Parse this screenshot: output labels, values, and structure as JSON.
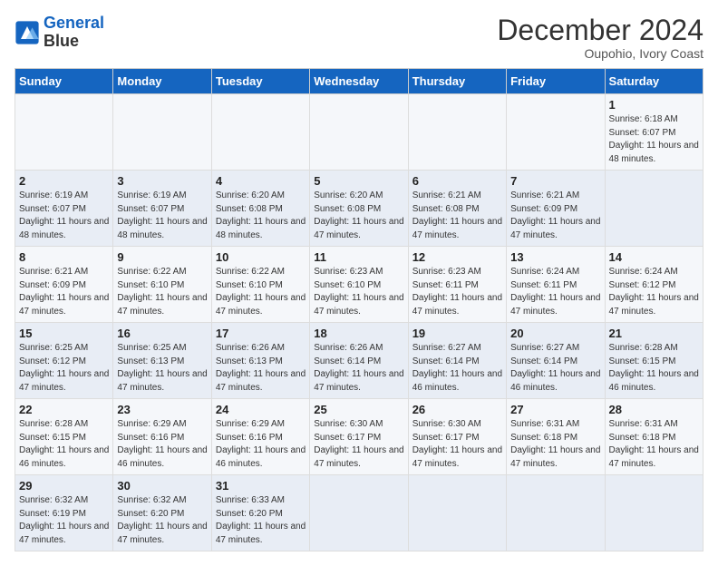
{
  "header": {
    "logo_line1": "General",
    "logo_line2": "Blue",
    "title": "December 2024",
    "subtitle": "Oupohio, Ivory Coast"
  },
  "calendar": {
    "days_of_week": [
      "Sunday",
      "Monday",
      "Tuesday",
      "Wednesday",
      "Thursday",
      "Friday",
      "Saturday"
    ],
    "weeks": [
      [
        null,
        null,
        null,
        null,
        null,
        null,
        {
          "day": 1,
          "rise": "6:18 AM",
          "set": "6:07 PM",
          "daylight": "11 hours and 48 minutes."
        }
      ],
      [
        {
          "day": 2,
          "rise": "6:19 AM",
          "set": "6:07 PM",
          "daylight": "11 hours and 48 minutes."
        },
        {
          "day": 3,
          "rise": "6:19 AM",
          "set": "6:07 PM",
          "daylight": "11 hours and 48 minutes."
        },
        {
          "day": 4,
          "rise": "6:20 AM",
          "set": "6:08 PM",
          "daylight": "11 hours and 48 minutes."
        },
        {
          "day": 5,
          "rise": "6:20 AM",
          "set": "6:08 PM",
          "daylight": "11 hours and 47 minutes."
        },
        {
          "day": 6,
          "rise": "6:21 AM",
          "set": "6:08 PM",
          "daylight": "11 hours and 47 minutes."
        },
        {
          "day": 7,
          "rise": "6:21 AM",
          "set": "6:09 PM",
          "daylight": "11 hours and 47 minutes."
        }
      ],
      [
        {
          "day": 8,
          "rise": "6:21 AM",
          "set": "6:09 PM",
          "daylight": "11 hours and 47 minutes."
        },
        {
          "day": 9,
          "rise": "6:22 AM",
          "set": "6:10 PM",
          "daylight": "11 hours and 47 minutes."
        },
        {
          "day": 10,
          "rise": "6:22 AM",
          "set": "6:10 PM",
          "daylight": "11 hours and 47 minutes."
        },
        {
          "day": 11,
          "rise": "6:23 AM",
          "set": "6:10 PM",
          "daylight": "11 hours and 47 minutes."
        },
        {
          "day": 12,
          "rise": "6:23 AM",
          "set": "6:11 PM",
          "daylight": "11 hours and 47 minutes."
        },
        {
          "day": 13,
          "rise": "6:24 AM",
          "set": "6:11 PM",
          "daylight": "11 hours and 47 minutes."
        },
        {
          "day": 14,
          "rise": "6:24 AM",
          "set": "6:12 PM",
          "daylight": "11 hours and 47 minutes."
        }
      ],
      [
        {
          "day": 15,
          "rise": "6:25 AM",
          "set": "6:12 PM",
          "daylight": "11 hours and 47 minutes."
        },
        {
          "day": 16,
          "rise": "6:25 AM",
          "set": "6:13 PM",
          "daylight": "11 hours and 47 minutes."
        },
        {
          "day": 17,
          "rise": "6:26 AM",
          "set": "6:13 PM",
          "daylight": "11 hours and 47 minutes."
        },
        {
          "day": 18,
          "rise": "6:26 AM",
          "set": "6:14 PM",
          "daylight": "11 hours and 47 minutes."
        },
        {
          "day": 19,
          "rise": "6:27 AM",
          "set": "6:14 PM",
          "daylight": "11 hours and 46 minutes."
        },
        {
          "day": 20,
          "rise": "6:27 AM",
          "set": "6:14 PM",
          "daylight": "11 hours and 46 minutes."
        },
        {
          "day": 21,
          "rise": "6:28 AM",
          "set": "6:15 PM",
          "daylight": "11 hours and 46 minutes."
        }
      ],
      [
        {
          "day": 22,
          "rise": "6:28 AM",
          "set": "6:15 PM",
          "daylight": "11 hours and 46 minutes."
        },
        {
          "day": 23,
          "rise": "6:29 AM",
          "set": "6:16 PM",
          "daylight": "11 hours and 46 minutes."
        },
        {
          "day": 24,
          "rise": "6:29 AM",
          "set": "6:16 PM",
          "daylight": "11 hours and 46 minutes."
        },
        {
          "day": 25,
          "rise": "6:30 AM",
          "set": "6:17 PM",
          "daylight": "11 hours and 47 minutes."
        },
        {
          "day": 26,
          "rise": "6:30 AM",
          "set": "6:17 PM",
          "daylight": "11 hours and 47 minutes."
        },
        {
          "day": 27,
          "rise": "6:31 AM",
          "set": "6:18 PM",
          "daylight": "11 hours and 47 minutes."
        },
        {
          "day": 28,
          "rise": "6:31 AM",
          "set": "6:18 PM",
          "daylight": "11 hours and 47 minutes."
        }
      ],
      [
        {
          "day": 29,
          "rise": "6:32 AM",
          "set": "6:19 PM",
          "daylight": "11 hours and 47 minutes."
        },
        {
          "day": 30,
          "rise": "6:32 AM",
          "set": "6:20 PM",
          "daylight": "11 hours and 47 minutes."
        },
        {
          "day": 31,
          "rise": "6:33 AM",
          "set": "6:20 PM",
          "daylight": "11 hours and 47 minutes."
        },
        null,
        null,
        null,
        null
      ]
    ]
  }
}
